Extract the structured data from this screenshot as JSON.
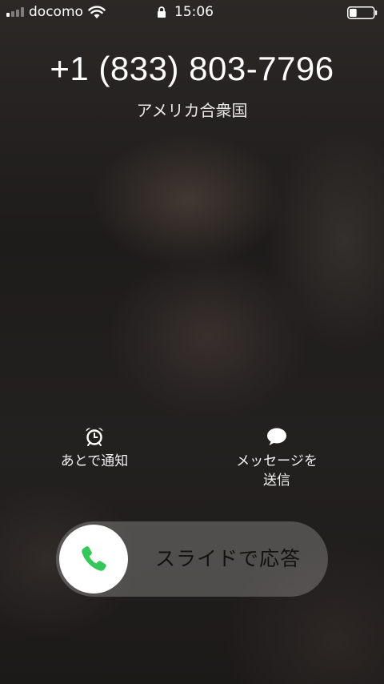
{
  "status_bar": {
    "carrier": "docomo",
    "time": "15:06",
    "signal_bars": 4,
    "signal_bars_active": 1,
    "battery_level": 0.3,
    "icons": [
      "signal-icon",
      "wifi-icon",
      "lock-icon",
      "battery-icon"
    ]
  },
  "caller": {
    "number": "+1 (833) 803-7796",
    "location": "アメリカ合衆国"
  },
  "actions": {
    "remind": {
      "label": "あとで通知",
      "icon": "alarm-clock-icon"
    },
    "message": {
      "label": "メッセージを\n送信",
      "icon": "message-bubble-icon"
    }
  },
  "slider": {
    "label": "スライドで応答",
    "icon": "phone-icon",
    "accent": "#34c759"
  }
}
